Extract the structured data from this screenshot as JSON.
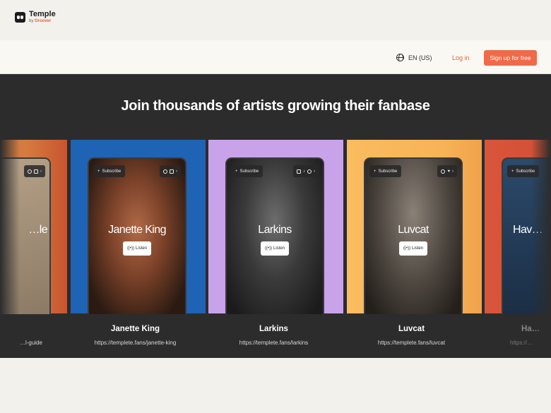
{
  "header": {
    "logo_name": "Temple",
    "logo_by": "by ",
    "logo_brand": "Groover",
    "language": "EN (US)",
    "login": "Log in",
    "signup": "Sign up for free"
  },
  "hero": {
    "title": "Join thousands of artists growing their fanbase"
  },
  "card_ui": {
    "subscribe": "Subscribe",
    "listen": "Listen"
  },
  "artists": [
    {
      "name": "",
      "url": "…l-guide",
      "phone_name": "…le"
    },
    {
      "name": "Janette King",
      "url": "https://templete.fans/janette-king",
      "phone_name": "Janette King"
    },
    {
      "name": "Larkins",
      "url": "https://templete.fans/larkins",
      "phone_name": "Larkins"
    },
    {
      "name": "Luvcat",
      "url": "https://templete.fans/luvcat",
      "phone_name": "Luvcat"
    },
    {
      "name": "Ha…",
      "url": "https://…",
      "phone_name": "Hav…"
    }
  ],
  "colors": {
    "accent": "#ef6a4a",
    "hero_bg": "#2c2c2c",
    "card_blue": "#1f63b5",
    "card_lilac": "#c9a3ea",
    "card_yellow": "#f9bc5f",
    "card_red": "#d9553a"
  },
  "icons": [
    "globe-icon",
    "plus-icon",
    "chevron-right-icon",
    "instagram-icon",
    "tiktok-icon",
    "facebook-icon",
    "heart-icon",
    "spotify-icon",
    "listen-wave-icon"
  ]
}
